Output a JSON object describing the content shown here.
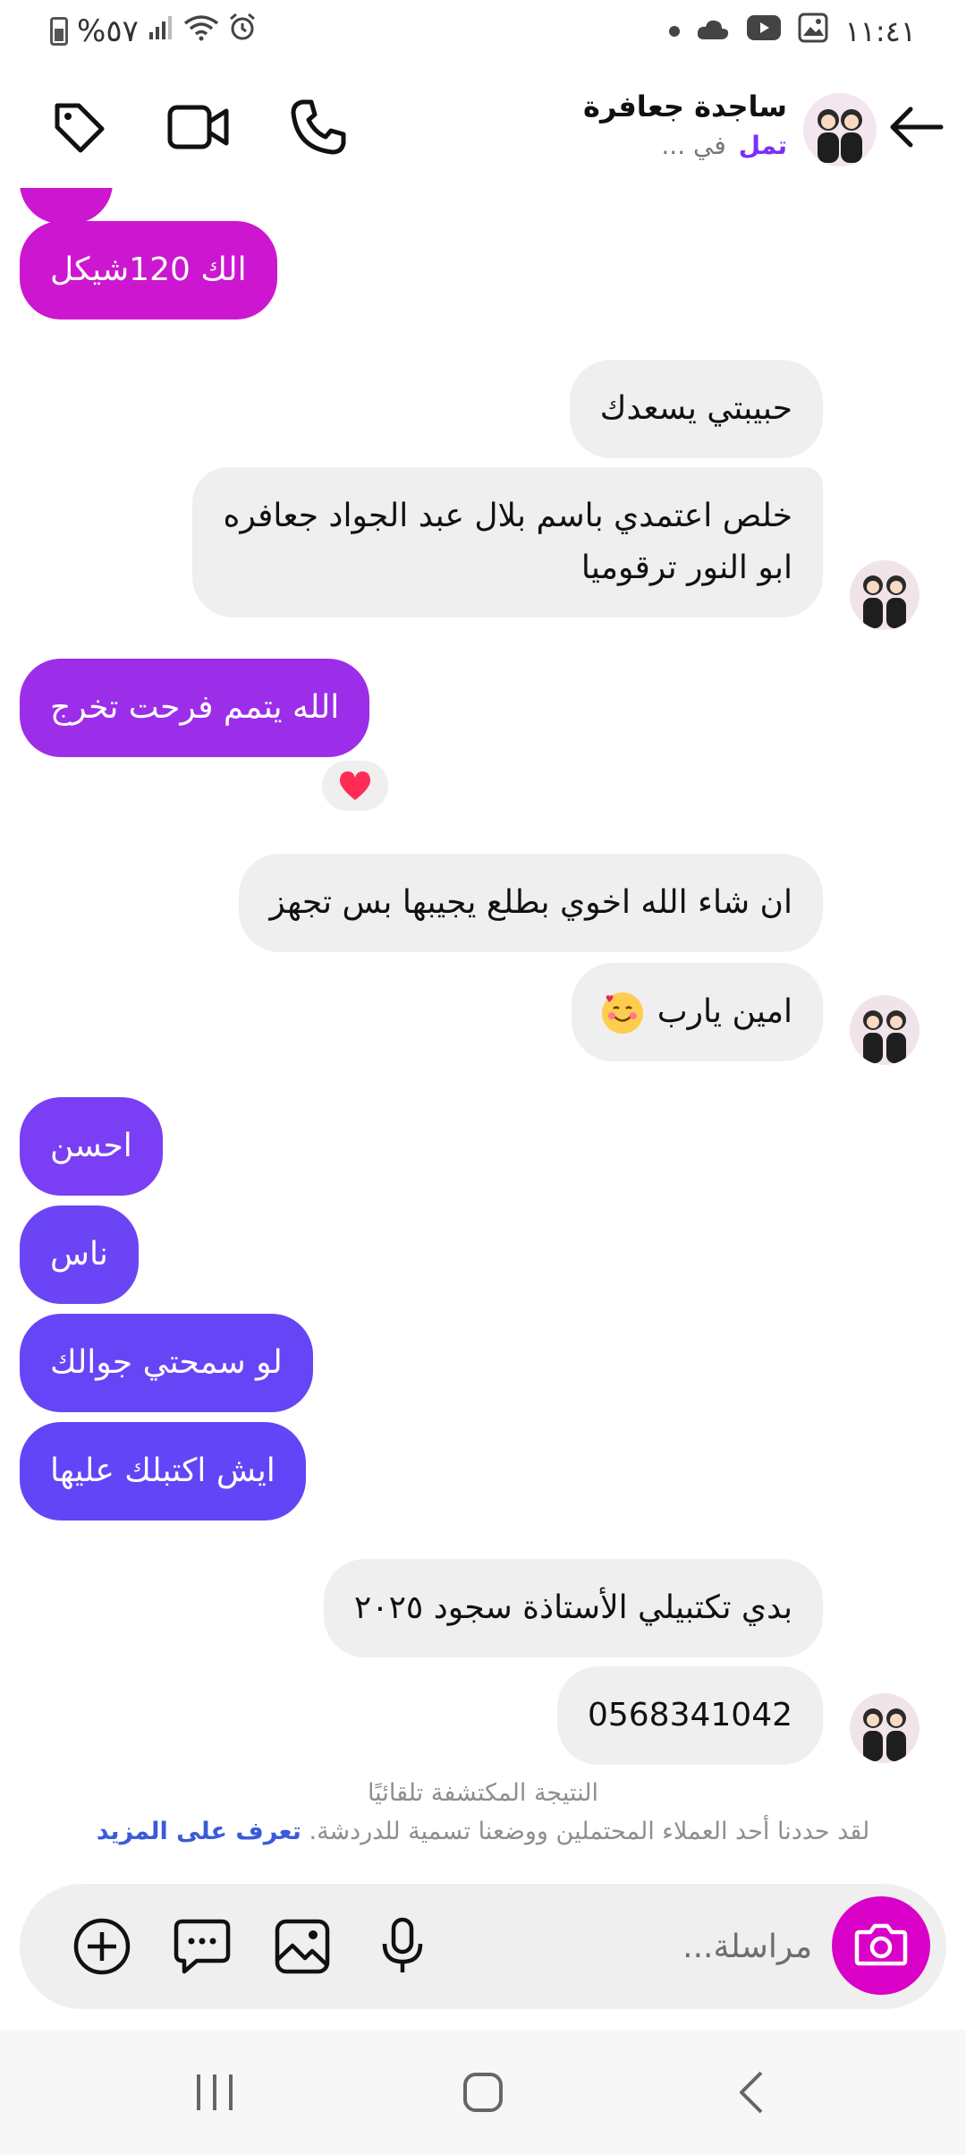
{
  "status_bar": {
    "battery": "%٥٧",
    "time": "١١:٤١"
  },
  "header": {
    "contact_name": "ساجدة جعافرة",
    "label": "تمل",
    "status": "في ..."
  },
  "messages": [
    {
      "id": "m1",
      "side": "out",
      "text": "الك 120شيكل",
      "color": "#cc16d0"
    },
    {
      "id": "m2",
      "side": "in",
      "text": "حبيبتي يسعدك"
    },
    {
      "id": "m3",
      "side": "in",
      "line1": "خلص اعتمدي باسم بلال عبد الجواد جعافره",
      "line2": "ابو النور ترقوميا"
    },
    {
      "id": "m4",
      "side": "out",
      "text": "الله يتمم فرحت تخرج",
      "color": "#9c2de8",
      "reaction": "heart"
    },
    {
      "id": "m5",
      "side": "in",
      "text": "ان شاء الله اخوي بطلع يجيبها بس تجهز"
    },
    {
      "id": "m6",
      "side": "in",
      "text": "امين يارب",
      "emoji": "smiling-face-with-hearts"
    },
    {
      "id": "m7",
      "side": "out",
      "text": "احسن",
      "color": "#7a3ef5"
    },
    {
      "id": "m8",
      "side": "out",
      "text": "ناس",
      "color": "#6b45f5"
    },
    {
      "id": "m9",
      "side": "out",
      "text": "لو سمحتي جوالك",
      "color": "#6645f7"
    },
    {
      "id": "m10",
      "side": "out",
      "text": "ايش اكتبلك عليها",
      "color": "#6245f7"
    },
    {
      "id": "m11",
      "side": "in",
      "text": "بدي تكتبيلي الأستاذة سجود ٢٠٢٥"
    },
    {
      "id": "m12",
      "side": "in",
      "text": "0568341042"
    }
  ],
  "notice": {
    "title": "النتيجة المكتشفة تلقائيًا",
    "body": "لقد حددنا أحد العملاء المحتملين ووضعنا تسمية للدردشة.",
    "link": "تعرف على المزيد"
  },
  "composer": {
    "placeholder": "مراسلة..."
  },
  "colors": {
    "camera_button": "#d900c8",
    "label_purple": "#7b2ff7",
    "link_blue": "#3a5bd9"
  },
  "icons": [
    "back-arrow-icon",
    "phone-icon",
    "video-camera-icon",
    "tag-icon",
    "camera-icon",
    "microphone-icon",
    "gallery-icon",
    "sticker-icon",
    "plus-icon",
    "recents-icon",
    "home-icon",
    "nav-back-icon"
  ]
}
